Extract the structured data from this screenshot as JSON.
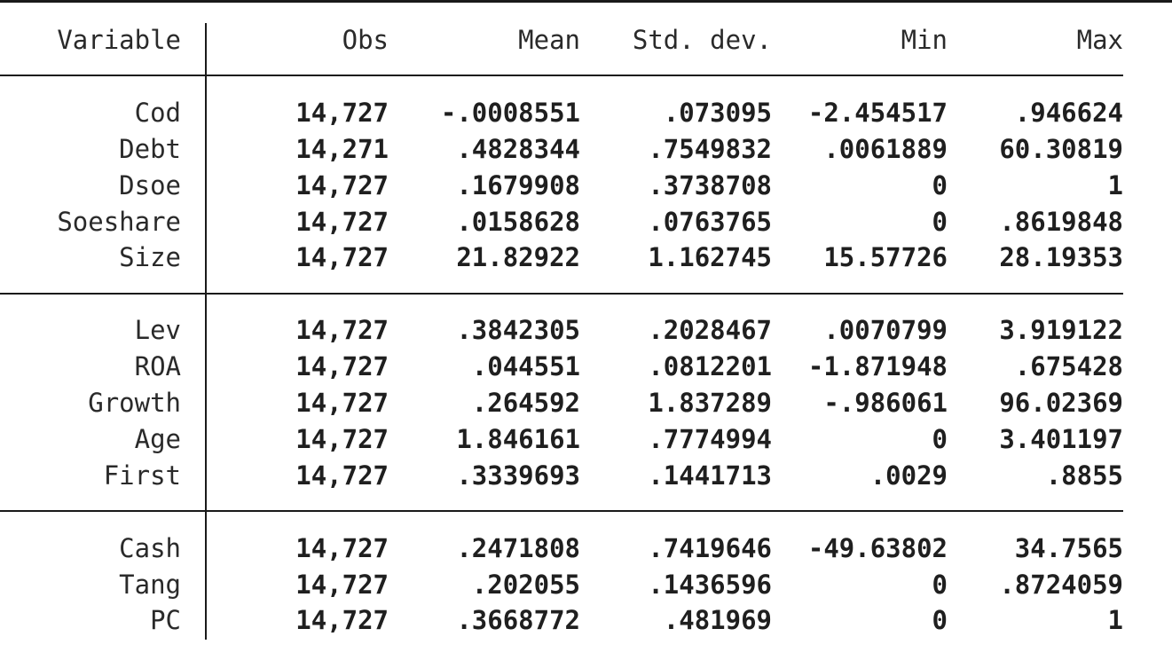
{
  "table": {
    "columns": [
      "Variable",
      "Obs",
      "Mean",
      "Std. dev.",
      "Min",
      "Max"
    ],
    "groups": [
      {
        "rows": [
          {
            "variable": "Cod",
            "obs": "14,727",
            "mean": "-.0008551",
            "sd": ".073095",
            "min": "-2.454517",
            "max": ".946624"
          },
          {
            "variable": "Debt",
            "obs": "14,271",
            "mean": ".4828344",
            "sd": ".7549832",
            "min": ".0061889",
            "max": "60.30819"
          },
          {
            "variable": "Dsoe",
            "obs": "14,727",
            "mean": ".1679908",
            "sd": ".3738708",
            "min": "0",
            "max": "1"
          },
          {
            "variable": "Soeshare",
            "obs": "14,727",
            "mean": ".0158628",
            "sd": ".0763765",
            "min": "0",
            "max": ".8619848"
          },
          {
            "variable": "Size",
            "obs": "14,727",
            "mean": "21.82922",
            "sd": "1.162745",
            "min": "15.57726",
            "max": "28.19353"
          }
        ]
      },
      {
        "rows": [
          {
            "variable": "Lev",
            "obs": "14,727",
            "mean": ".3842305",
            "sd": ".2028467",
            "min": ".0070799",
            "max": "3.919122"
          },
          {
            "variable": "ROA",
            "obs": "14,727",
            "mean": ".044551",
            "sd": ".0812201",
            "min": "-1.871948",
            "max": ".675428"
          },
          {
            "variable": "Growth",
            "obs": "14,727",
            "mean": ".264592",
            "sd": "1.837289",
            "min": "-.986061",
            "max": "96.02369"
          },
          {
            "variable": "Age",
            "obs": "14,727",
            "mean": "1.846161",
            "sd": ".7774994",
            "min": "0",
            "max": "3.401197"
          },
          {
            "variable": "First",
            "obs": "14,727",
            "mean": ".3339693",
            "sd": ".1441713",
            "min": ".0029",
            "max": ".8855"
          }
        ]
      },
      {
        "rows": [
          {
            "variable": "Cash",
            "obs": "14,727",
            "mean": ".2471808",
            "sd": ".7419646",
            "min": "-49.63802",
            "max": "34.7565"
          },
          {
            "variable": "Tang",
            "obs": "14,727",
            "mean": ".202055",
            "sd": ".1436596",
            "min": "0",
            "max": ".8724059"
          },
          {
            "variable": "PC",
            "obs": "14,727",
            "mean": ".3668772",
            "sd": ".481969",
            "min": "0",
            "max": "1"
          }
        ]
      }
    ]
  }
}
